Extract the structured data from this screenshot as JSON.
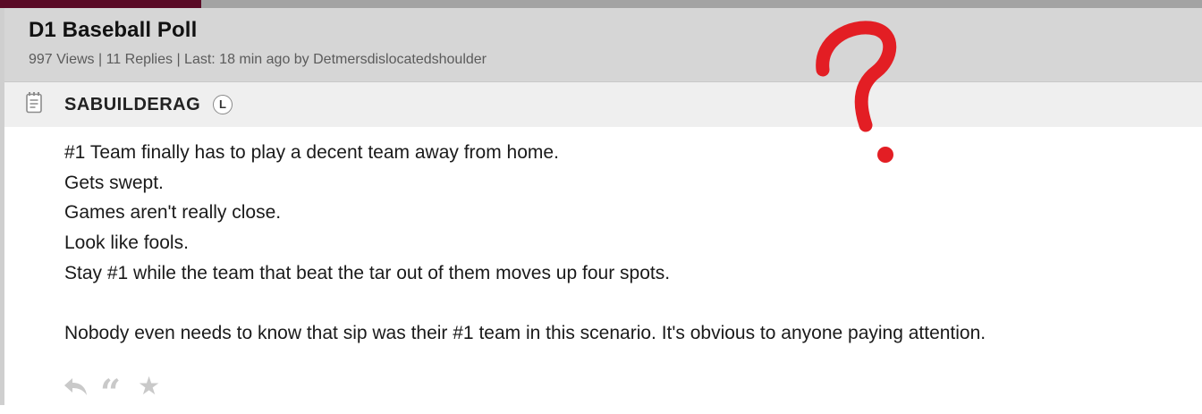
{
  "thread": {
    "title": "D1 Baseball Poll",
    "meta": "997 Views | 11 Replies | Last: 18 min ago by Detmersdislocatedshoulder"
  },
  "post": {
    "author": "SABUILDERAG",
    "author_badge": "L",
    "lines": [
      "#1 Team finally has to play a decent team away from home.",
      "Gets swept.",
      "Games aren't really close.",
      "Look like fools.",
      "Stay #1 while the team that beat the tar out of them moves up four spots.",
      "",
      "Nobody even needs to know that sip was their #1 team in this scenario. It's obvious to anyone paying attention."
    ]
  },
  "actions": {
    "reply_icon": "reply-arrow-icon",
    "quote_icon": "quote-icon",
    "quote_glyph": "“",
    "star_icon": "star-icon",
    "star_glyph": "★"
  },
  "annotation": {
    "mark": "red-question-mark-icon"
  },
  "colors": {
    "accent": "#5a0a26",
    "topbar": "#a3a3a3",
    "header_bg": "#d6d6d6",
    "poster_bg": "#efefef",
    "annotation_red": "#e31e24",
    "icon_gray": "#c9c9c9"
  }
}
